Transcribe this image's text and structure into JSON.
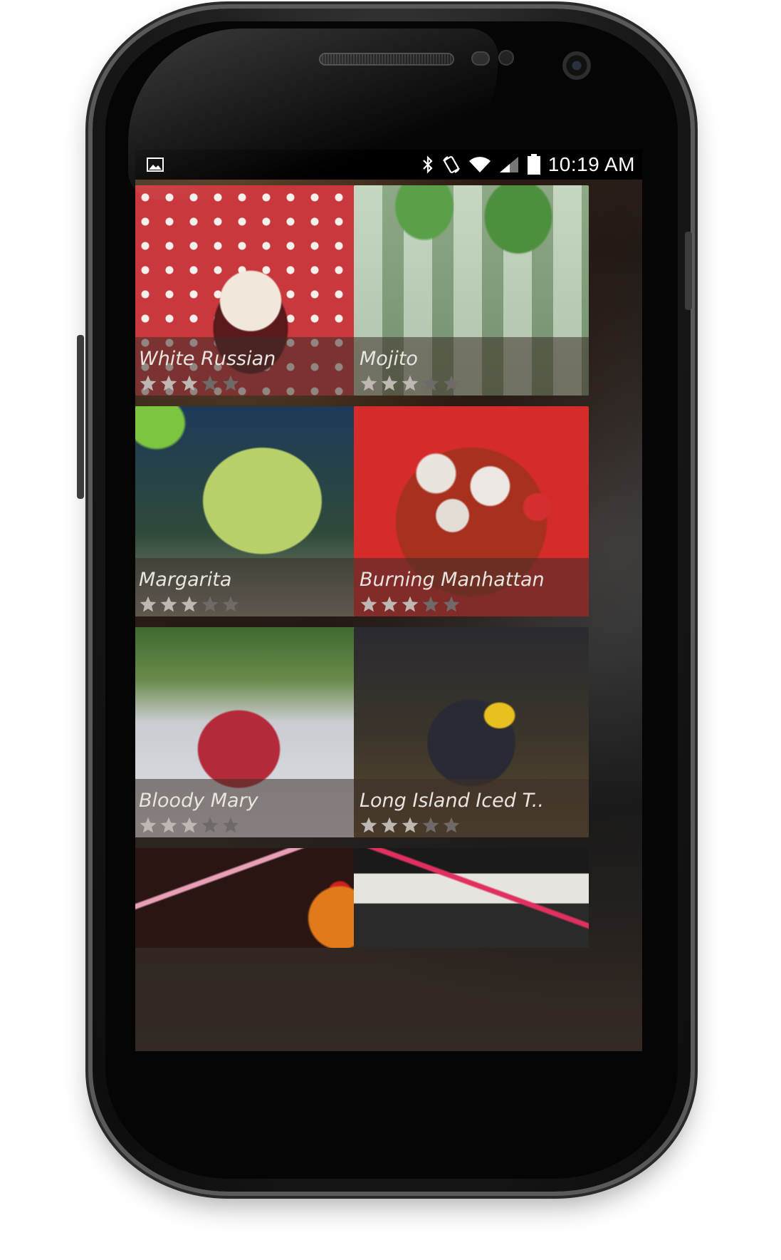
{
  "status_bar": {
    "time": "10:19 AM",
    "icons": [
      "gallery-notification-icon",
      "bluetooth-icon",
      "rotation-icon",
      "wifi-icon",
      "signal-icon",
      "battery-icon"
    ]
  },
  "drinks": [
    {
      "name": "White Russian",
      "rating": 3,
      "max_rating": 5,
      "theme": "red-polka-dot"
    },
    {
      "name": "Mojito",
      "rating": 3,
      "max_rating": 5,
      "theme": "green-mint"
    },
    {
      "name": "Margarita",
      "rating": 3,
      "max_rating": 5,
      "theme": "lime-green"
    },
    {
      "name": "Burning Manhattan",
      "rating": 3,
      "max_rating": 5,
      "theme": "red-ice"
    },
    {
      "name": "Bloody Mary",
      "rating": 3,
      "max_rating": 5,
      "theme": "garden-red"
    },
    {
      "name": "Long Island Iced T..",
      "rating": 3,
      "max_rating": 5,
      "theme": "dark-lemon"
    },
    {
      "name": "",
      "rating": 0,
      "max_rating": 5,
      "theme": "orange-straw"
    },
    {
      "name": "",
      "rating": 0,
      "max_rating": 5,
      "theme": "white-tray"
    }
  ],
  "colors": {
    "star_filled": "#bfb7b2",
    "star_empty": "#6f6a67",
    "caption_text": "#e8e4e0"
  }
}
